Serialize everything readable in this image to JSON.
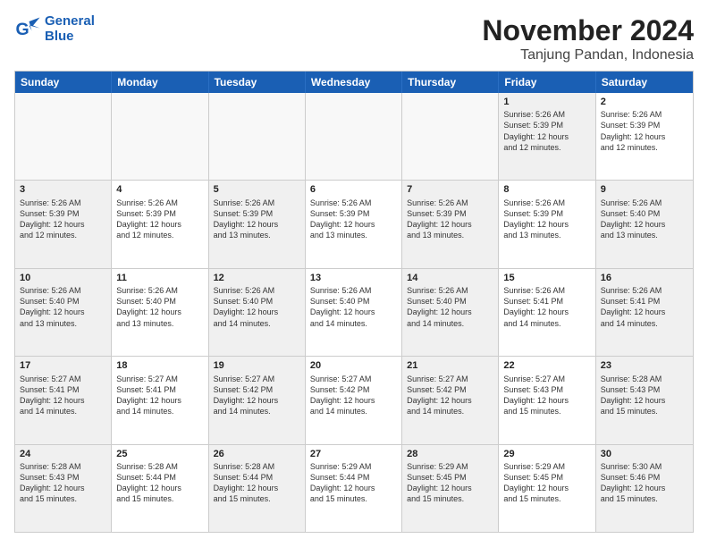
{
  "logo": {
    "line1": "General",
    "line2": "Blue"
  },
  "title": "November 2024",
  "subtitle": "Tanjung Pandan, Indonesia",
  "days": [
    "Sunday",
    "Monday",
    "Tuesday",
    "Wednesday",
    "Thursday",
    "Friday",
    "Saturday"
  ],
  "rows": [
    [
      {
        "num": "",
        "text": "",
        "empty": true
      },
      {
        "num": "",
        "text": "",
        "empty": true
      },
      {
        "num": "",
        "text": "",
        "empty": true
      },
      {
        "num": "",
        "text": "",
        "empty": true
      },
      {
        "num": "",
        "text": "",
        "empty": true
      },
      {
        "num": "1",
        "text": "Sunrise: 5:26 AM\nSunset: 5:39 PM\nDaylight: 12 hours\nand 12 minutes.",
        "empty": false,
        "shaded": true
      },
      {
        "num": "2",
        "text": "Sunrise: 5:26 AM\nSunset: 5:39 PM\nDaylight: 12 hours\nand 12 minutes.",
        "empty": false,
        "shaded": false
      }
    ],
    [
      {
        "num": "3",
        "text": "Sunrise: 5:26 AM\nSunset: 5:39 PM\nDaylight: 12 hours\nand 12 minutes.",
        "empty": false,
        "shaded": true
      },
      {
        "num": "4",
        "text": "Sunrise: 5:26 AM\nSunset: 5:39 PM\nDaylight: 12 hours\nand 12 minutes.",
        "empty": false,
        "shaded": false
      },
      {
        "num": "5",
        "text": "Sunrise: 5:26 AM\nSunset: 5:39 PM\nDaylight: 12 hours\nand 13 minutes.",
        "empty": false,
        "shaded": true
      },
      {
        "num": "6",
        "text": "Sunrise: 5:26 AM\nSunset: 5:39 PM\nDaylight: 12 hours\nand 13 minutes.",
        "empty": false,
        "shaded": false
      },
      {
        "num": "7",
        "text": "Sunrise: 5:26 AM\nSunset: 5:39 PM\nDaylight: 12 hours\nand 13 minutes.",
        "empty": false,
        "shaded": true
      },
      {
        "num": "8",
        "text": "Sunrise: 5:26 AM\nSunset: 5:39 PM\nDaylight: 12 hours\nand 13 minutes.",
        "empty": false,
        "shaded": false
      },
      {
        "num": "9",
        "text": "Sunrise: 5:26 AM\nSunset: 5:40 PM\nDaylight: 12 hours\nand 13 minutes.",
        "empty": false,
        "shaded": true
      }
    ],
    [
      {
        "num": "10",
        "text": "Sunrise: 5:26 AM\nSunset: 5:40 PM\nDaylight: 12 hours\nand 13 minutes.",
        "empty": false,
        "shaded": true
      },
      {
        "num": "11",
        "text": "Sunrise: 5:26 AM\nSunset: 5:40 PM\nDaylight: 12 hours\nand 13 minutes.",
        "empty": false,
        "shaded": false
      },
      {
        "num": "12",
        "text": "Sunrise: 5:26 AM\nSunset: 5:40 PM\nDaylight: 12 hours\nand 14 minutes.",
        "empty": false,
        "shaded": true
      },
      {
        "num": "13",
        "text": "Sunrise: 5:26 AM\nSunset: 5:40 PM\nDaylight: 12 hours\nand 14 minutes.",
        "empty": false,
        "shaded": false
      },
      {
        "num": "14",
        "text": "Sunrise: 5:26 AM\nSunset: 5:40 PM\nDaylight: 12 hours\nand 14 minutes.",
        "empty": false,
        "shaded": true
      },
      {
        "num": "15",
        "text": "Sunrise: 5:26 AM\nSunset: 5:41 PM\nDaylight: 12 hours\nand 14 minutes.",
        "empty": false,
        "shaded": false
      },
      {
        "num": "16",
        "text": "Sunrise: 5:26 AM\nSunset: 5:41 PM\nDaylight: 12 hours\nand 14 minutes.",
        "empty": false,
        "shaded": true
      }
    ],
    [
      {
        "num": "17",
        "text": "Sunrise: 5:27 AM\nSunset: 5:41 PM\nDaylight: 12 hours\nand 14 minutes.",
        "empty": false,
        "shaded": true
      },
      {
        "num": "18",
        "text": "Sunrise: 5:27 AM\nSunset: 5:41 PM\nDaylight: 12 hours\nand 14 minutes.",
        "empty": false,
        "shaded": false
      },
      {
        "num": "19",
        "text": "Sunrise: 5:27 AM\nSunset: 5:42 PM\nDaylight: 12 hours\nand 14 minutes.",
        "empty": false,
        "shaded": true
      },
      {
        "num": "20",
        "text": "Sunrise: 5:27 AM\nSunset: 5:42 PM\nDaylight: 12 hours\nand 14 minutes.",
        "empty": false,
        "shaded": false
      },
      {
        "num": "21",
        "text": "Sunrise: 5:27 AM\nSunset: 5:42 PM\nDaylight: 12 hours\nand 14 minutes.",
        "empty": false,
        "shaded": true
      },
      {
        "num": "22",
        "text": "Sunrise: 5:27 AM\nSunset: 5:43 PM\nDaylight: 12 hours\nand 15 minutes.",
        "empty": false,
        "shaded": false
      },
      {
        "num": "23",
        "text": "Sunrise: 5:28 AM\nSunset: 5:43 PM\nDaylight: 12 hours\nand 15 minutes.",
        "empty": false,
        "shaded": true
      }
    ],
    [
      {
        "num": "24",
        "text": "Sunrise: 5:28 AM\nSunset: 5:43 PM\nDaylight: 12 hours\nand 15 minutes.",
        "empty": false,
        "shaded": true
      },
      {
        "num": "25",
        "text": "Sunrise: 5:28 AM\nSunset: 5:44 PM\nDaylight: 12 hours\nand 15 minutes.",
        "empty": false,
        "shaded": false
      },
      {
        "num": "26",
        "text": "Sunrise: 5:28 AM\nSunset: 5:44 PM\nDaylight: 12 hours\nand 15 minutes.",
        "empty": false,
        "shaded": true
      },
      {
        "num": "27",
        "text": "Sunrise: 5:29 AM\nSunset: 5:44 PM\nDaylight: 12 hours\nand 15 minutes.",
        "empty": false,
        "shaded": false
      },
      {
        "num": "28",
        "text": "Sunrise: 5:29 AM\nSunset: 5:45 PM\nDaylight: 12 hours\nand 15 minutes.",
        "empty": false,
        "shaded": true
      },
      {
        "num": "29",
        "text": "Sunrise: 5:29 AM\nSunset: 5:45 PM\nDaylight: 12 hours\nand 15 minutes.",
        "empty": false,
        "shaded": false
      },
      {
        "num": "30",
        "text": "Sunrise: 5:30 AM\nSunset: 5:46 PM\nDaylight: 12 hours\nand 15 minutes.",
        "empty": false,
        "shaded": true
      }
    ]
  ]
}
